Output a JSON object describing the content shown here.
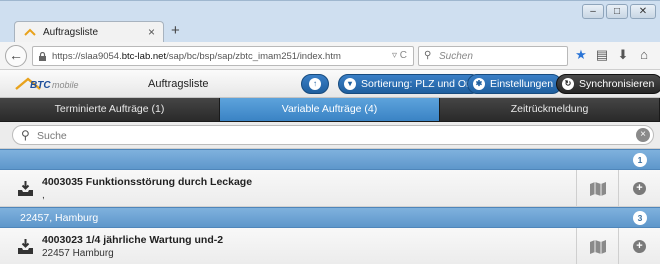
{
  "browser": {
    "tab_title": "Auftragsliste",
    "tab_close": "×",
    "new_tab": "+",
    "window_buttons": [
      "–",
      "□",
      "✕"
    ],
    "url_prefix": "https://slaa9054.",
    "url_domain": "btc-lab.net",
    "url_path": "/sap/bc/bsp/sap/zbtc_imam251/index.htm",
    "url_tools": "▿ C",
    "search_placeholder": "Suchen"
  },
  "app": {
    "logo_text": "BTCmobile",
    "title": "Auftragsliste",
    "buttons": {
      "up_icon": "↑",
      "sort_label": "Sortierung: PLZ und Ort",
      "settings_label": "Einstellungen",
      "sync_label": "Synchronisieren"
    },
    "tabs": [
      "Terminierte Aufträge (1)",
      "Variable Aufträge (4)",
      "Zeitrückmeldung"
    ],
    "active_tab": 1,
    "search_placeholder": "Suche",
    "groups": [
      {
        "label": "",
        "count": "1",
        "items": [
          {
            "title": "4003035 Funktionsstörung durch Leckage",
            "subtitle": ","
          }
        ]
      },
      {
        "label": "22457, Hamburg",
        "count": "3",
        "items": [
          {
            "title": "4003023 1/4 jährliche Wartung und-2",
            "subtitle": "22457 Hamburg"
          }
        ]
      }
    ]
  },
  "colors": {
    "accent_blue": "#3a83c4",
    "divider_blue": "#6fa4d4",
    "dark_bar": "#2f2f2f"
  }
}
